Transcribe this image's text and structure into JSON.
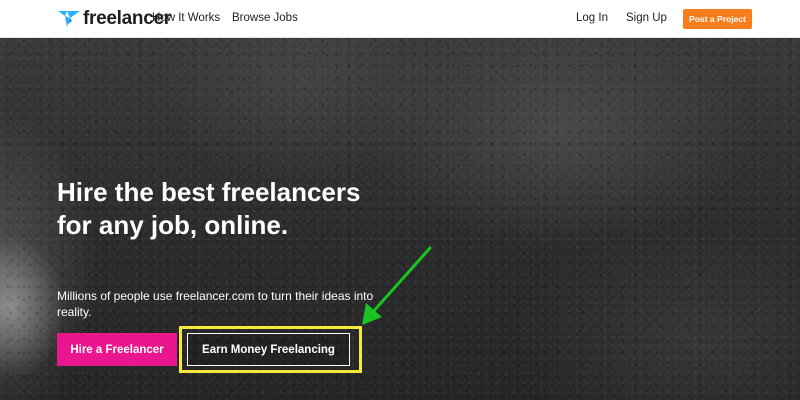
{
  "header": {
    "logo_text": "freelancer",
    "nav": {
      "how_it_works": "How It Works",
      "browse_jobs": "Browse Jobs",
      "log_in": "Log In",
      "sign_up": "Sign Up"
    },
    "post_project_label": "Post a Project"
  },
  "hero": {
    "headline": "Hire the best freelancers for any job, online.",
    "subtext": "Millions of people use freelancer.com to turn their ideas into reality.",
    "hire_button_label": "Hire a Freelancer",
    "earn_button_label": "Earn Money Freelancing"
  },
  "annotations": {
    "highlight_color": "#f4e83a",
    "arrow_color": "#19c424"
  },
  "colors": {
    "brand_blue": "#29b2fe",
    "post_button": "#f77d1d",
    "hire_button": "#e9168e"
  },
  "icons": {
    "logo": "freelancer-bird-logo-icon",
    "arrow": "green-arrow-icon"
  }
}
